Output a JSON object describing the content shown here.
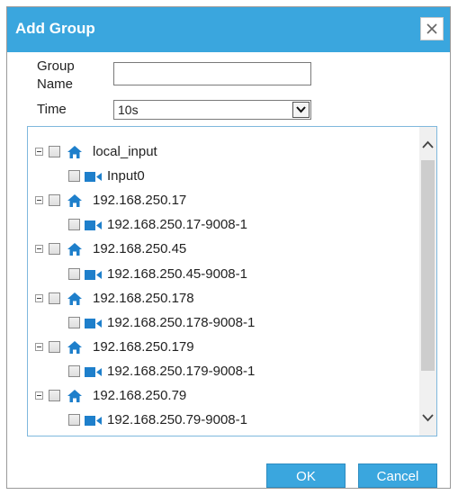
{
  "dialog": {
    "title": "Add Group",
    "close_label": "×"
  },
  "form": {
    "group_name_label_line1": "Group",
    "group_name_label_line2": "Name",
    "group_name_value": "",
    "time_label": "Time",
    "time_value": "10s"
  },
  "tree": {
    "items": [
      {
        "label": "local_input",
        "type": "host"
      },
      {
        "label": "Input0",
        "type": "camera"
      },
      {
        "label": "192.168.250.17",
        "type": "host"
      },
      {
        "label": "192.168.250.17-9008-1",
        "type": "camera"
      },
      {
        "label": "192.168.250.45",
        "type": "host"
      },
      {
        "label": "192.168.250.45-9008-1",
        "type": "camera"
      },
      {
        "label": "192.168.250.178",
        "type": "host"
      },
      {
        "label": "192.168.250.178-9008-1",
        "type": "camera"
      },
      {
        "label": "192.168.250.179",
        "type": "host"
      },
      {
        "label": "192.168.250.179-9008-1",
        "type": "camera"
      },
      {
        "label": "192.168.250.79",
        "type": "host"
      },
      {
        "label": "192.168.250.79-9008-1",
        "type": "camera"
      }
    ]
  },
  "buttons": {
    "ok": "OK",
    "cancel": "Cancel"
  },
  "colors": {
    "accent": "#3aa6de",
    "icon": "#1e7fcb"
  }
}
